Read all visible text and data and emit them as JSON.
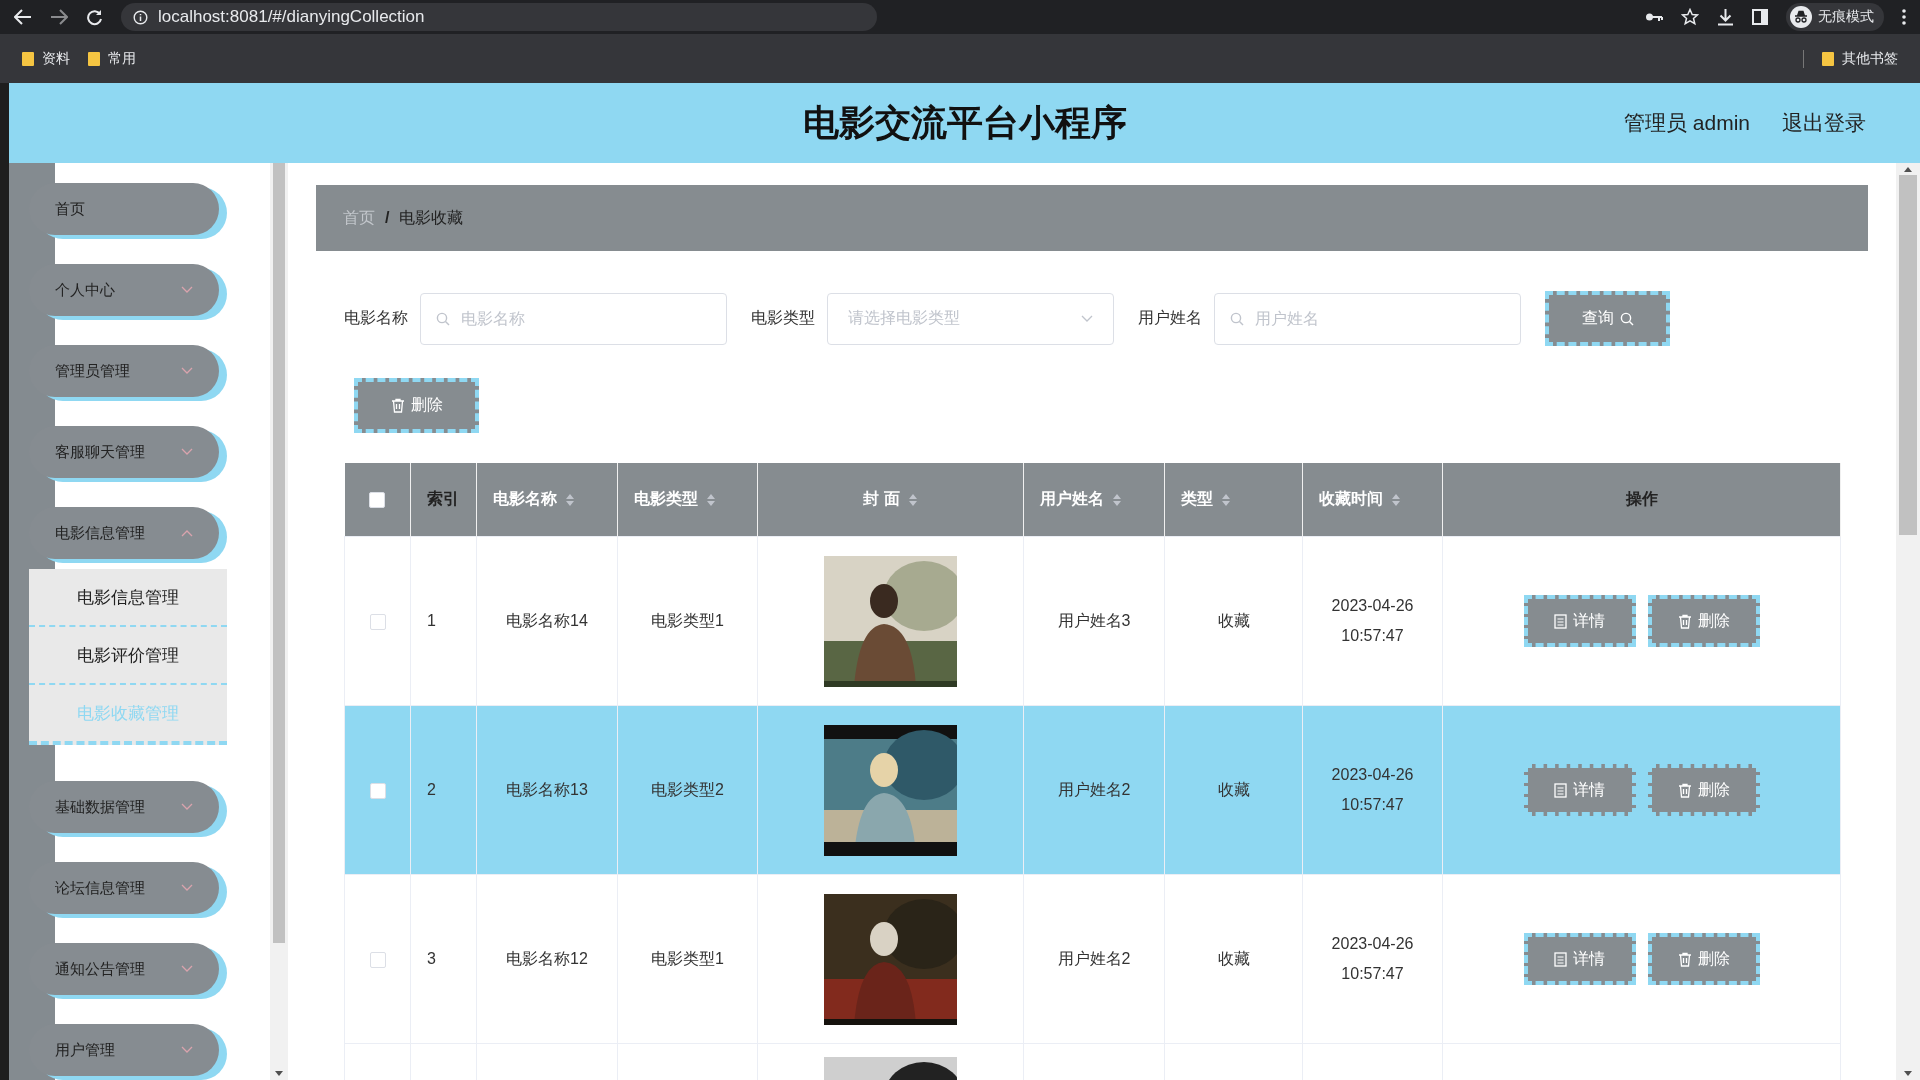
{
  "browser": {
    "url": "localhost:8081/#/dianyingCollection",
    "incognito_label": "无痕模式",
    "bookmarks": [
      "资料",
      "常用"
    ],
    "other_bookmarks": "其他书签"
  },
  "header": {
    "title": "电影交流平台小程序",
    "user": "管理员 admin",
    "logout": "退出登录"
  },
  "sidebar": {
    "items": [
      {
        "label": "首页",
        "has_arrow": false
      },
      {
        "label": "个人中心",
        "has_arrow": true,
        "expanded": false
      },
      {
        "label": "管理员管理",
        "has_arrow": true,
        "expanded": false
      },
      {
        "label": "客服聊天管理",
        "has_arrow": true,
        "expanded": false
      },
      {
        "label": "电影信息管理",
        "has_arrow": true,
        "expanded": true,
        "children": [
          {
            "label": "电影信息管理",
            "selected": false
          },
          {
            "label": "电影评价管理",
            "selected": false
          },
          {
            "label": "电影收藏管理",
            "selected": true
          }
        ]
      },
      {
        "label": "基础数据管理",
        "has_arrow": true,
        "expanded": false
      },
      {
        "label": "论坛信息管理",
        "has_arrow": true,
        "expanded": false
      },
      {
        "label": "通知公告管理",
        "has_arrow": true,
        "expanded": false
      },
      {
        "label": "用户管理",
        "has_arrow": true,
        "expanded": false
      }
    ]
  },
  "breadcrumb": {
    "items": [
      "首页",
      "电影收藏"
    ],
    "separator": "/"
  },
  "filters": [
    {
      "kind": "input",
      "label": "电影名称",
      "placeholder": "电影名称"
    },
    {
      "kind": "select",
      "label": "电影类型",
      "placeholder": "请选择电影类型"
    },
    {
      "kind": "input",
      "label": "用户姓名",
      "placeholder": "用户姓名"
    }
  ],
  "query_button": "查询",
  "delete_button": "删除",
  "table": {
    "header_checked": false,
    "columns": [
      {
        "label": "索引",
        "sortable": false
      },
      {
        "label": "电影名称",
        "sortable": true
      },
      {
        "label": "电影类型",
        "sortable": true
      },
      {
        "label": "封 面",
        "sortable": true
      },
      {
        "label": "用户姓名",
        "sortable": true
      },
      {
        "label": "类型",
        "sortable": true
      },
      {
        "label": "收藏时间",
        "sortable": true
      },
      {
        "label": "操作",
        "sortable": false
      }
    ],
    "rows": [
      {
        "selected": false,
        "checked": false,
        "index": "1",
        "name": "电影名称14",
        "type": "电影类型1",
        "cover": {
          "kind": "picture"
        },
        "user": "用户姓名3",
        "kind_text": "收藏",
        "time": [
          "2023-04-26",
          "10:57:47"
        ],
        "actions": [
          "详情",
          "删除"
        ]
      },
      {
        "selected": true,
        "checked": false,
        "index": "2",
        "name": "电影名称13",
        "type": "电影类型2",
        "cover": {
          "kind": "picture"
        },
        "user": "用户姓名2",
        "kind_text": "收藏",
        "time": [
          "2023-04-26",
          "10:57:47"
        ],
        "actions": [
          "详情",
          "删除"
        ]
      },
      {
        "selected": false,
        "checked": false,
        "index": "3",
        "name": "电影名称12",
        "type": "电影类型1",
        "cover": {
          "kind": "picture"
        },
        "user": "用户姓名2",
        "kind_text": "收藏",
        "time": [
          "2023-04-26",
          "10:57:47"
        ],
        "actions": [
          "详情",
          "删除"
        ]
      },
      {
        "selected": false,
        "cover": {
          "kind": "picture"
        }
      }
    ]
  }
}
